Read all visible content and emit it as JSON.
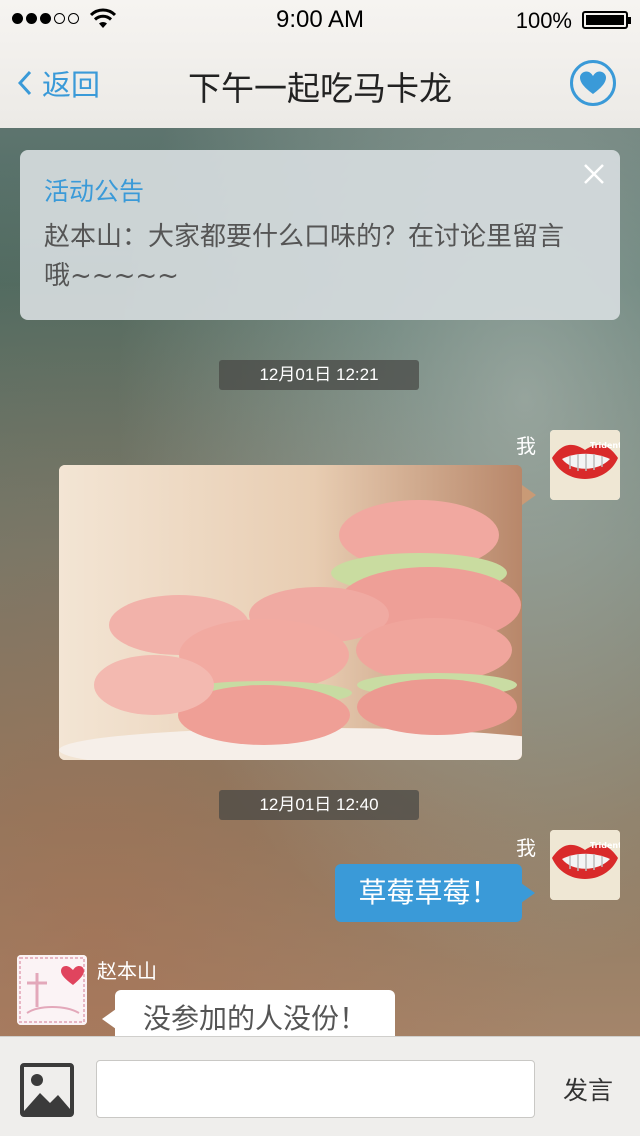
{
  "status_bar": {
    "time": "9:00 AM",
    "battery": "100%"
  },
  "nav": {
    "back_label": "返回",
    "title": "下午一起吃马卡龙"
  },
  "announcement": {
    "title": "活动公告",
    "text": "赵本山：大家都要什么口味的？在讨论里留言哦~~~~~"
  },
  "messages": [
    {
      "timestamp": "12月01日 12:21",
      "sender": "我",
      "type": "image",
      "image_subject": "macarons-photo"
    },
    {
      "timestamp": "12月01日 12:40",
      "sender": "我",
      "type": "text",
      "text": "草莓草莓！"
    },
    {
      "sender": "赵本山",
      "type": "text",
      "text": "没参加的人没份！"
    }
  ],
  "input_bar": {
    "placeholder": "",
    "send_label": "发言"
  },
  "colors": {
    "accent": "#3a9ad8",
    "timestamp_bg": "#464644"
  }
}
